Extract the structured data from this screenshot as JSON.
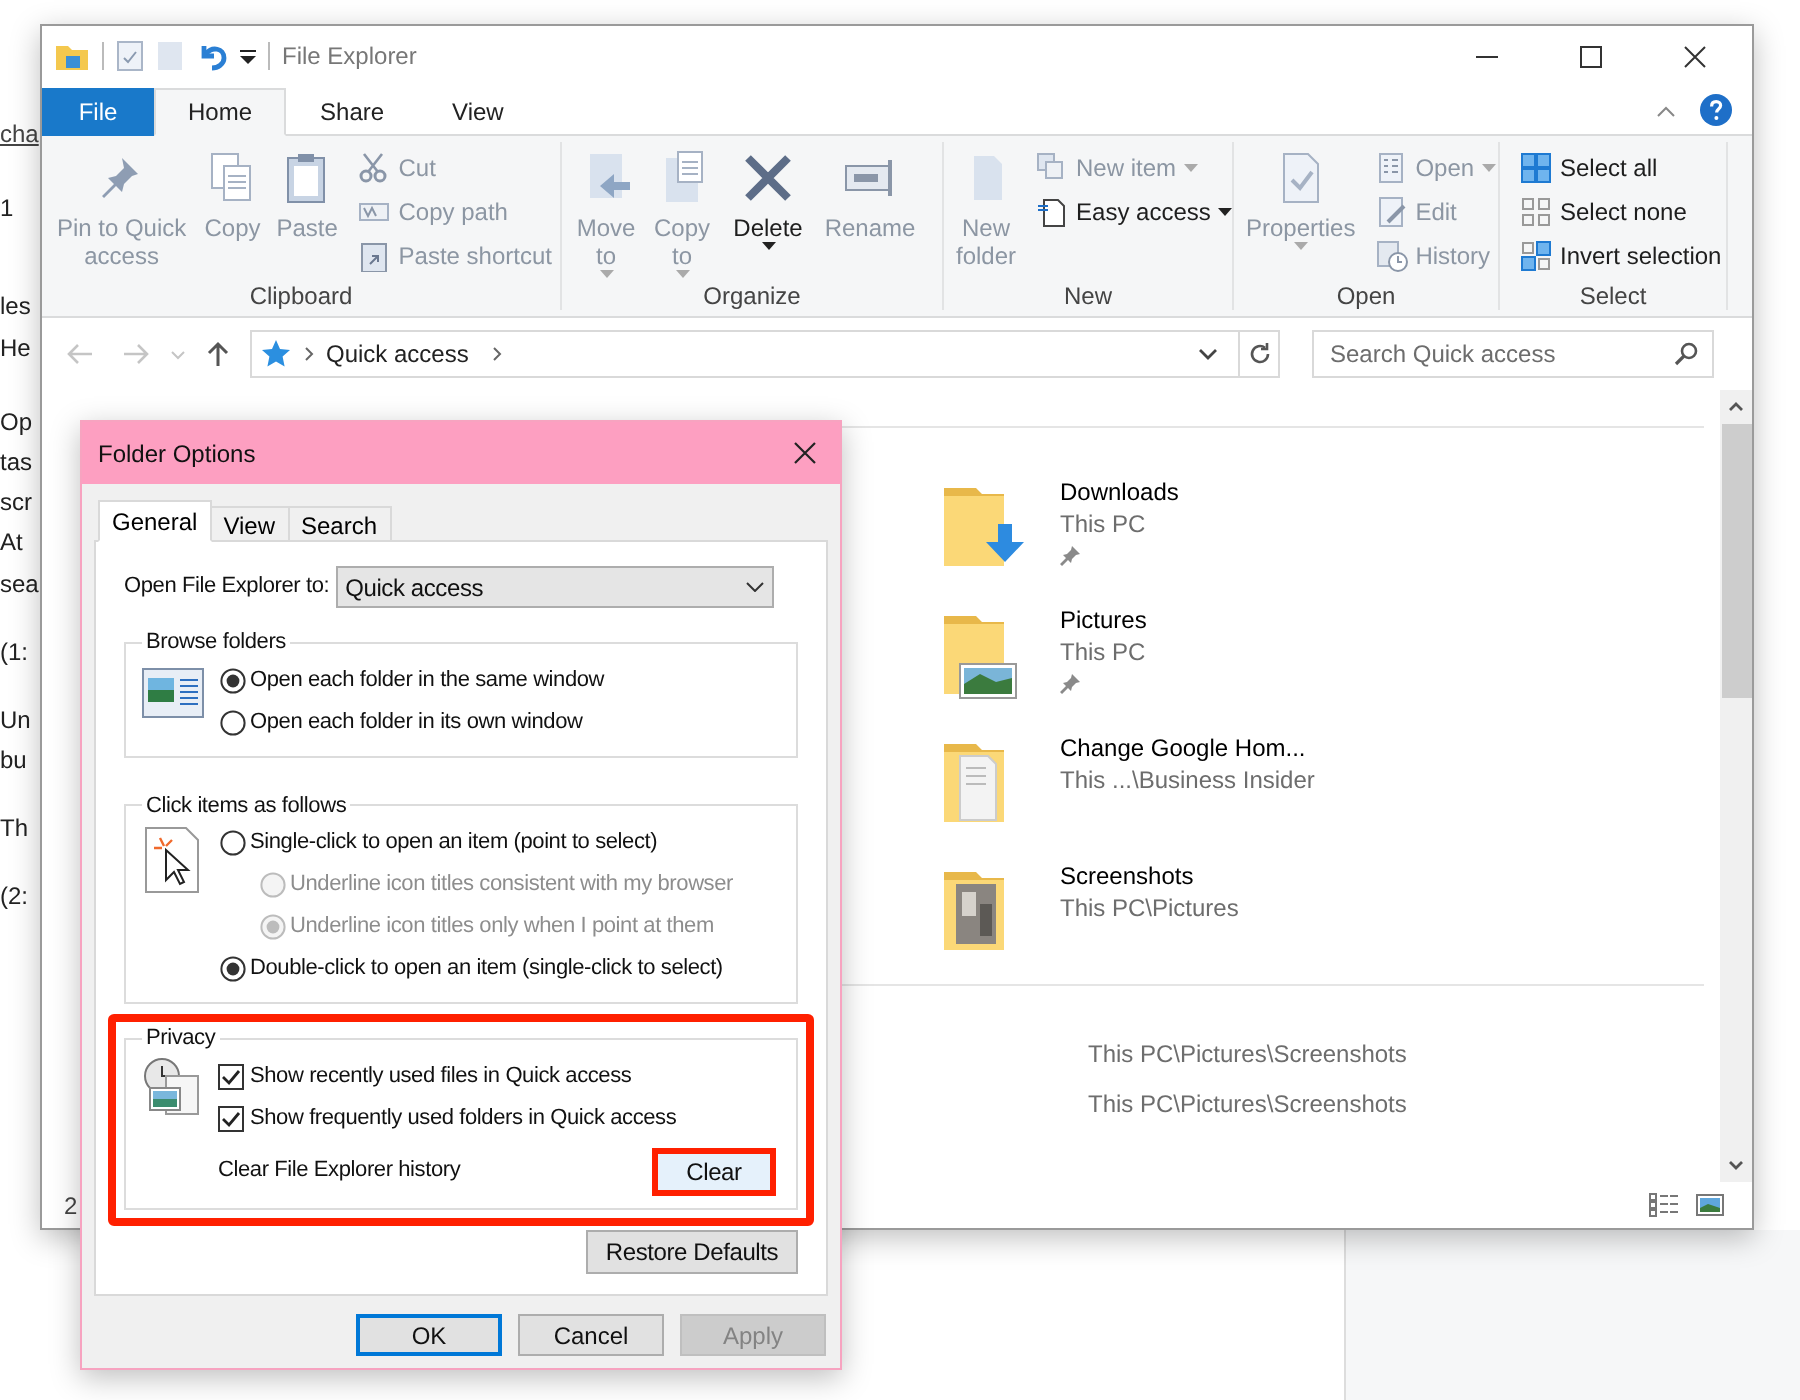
{
  "background_document": {
    "lines": [
      {
        "text": "cha",
        "link": true
      },
      {
        "text": "1",
        "link": false
      },
      {
        "text": "les",
        "link": false
      },
      {
        "text": "He",
        "link": false
      },
      {
        "text": "Op",
        "link": false
      },
      {
        "text": "tas",
        "link": false
      },
      {
        "text": "scr",
        "link": false
      },
      {
        "text": "At",
        "link": false
      },
      {
        "text": "sea",
        "link": false
      },
      {
        "text": "(1:",
        "link": false
      },
      {
        "text": "Un",
        "link": false
      },
      {
        "text": "bu",
        "link": false
      },
      {
        "text": "Th",
        "link": false
      },
      {
        "text": "(2:",
        "link": false
      }
    ]
  },
  "explorer": {
    "title": "File Explorer",
    "tabs": [
      {
        "label": "File",
        "kind": "file",
        "selected": false
      },
      {
        "label": "Home",
        "kind": "tab",
        "selected": true
      },
      {
        "label": "Share",
        "kind": "tab",
        "selected": false
      },
      {
        "label": "View",
        "kind": "tab",
        "selected": false
      }
    ],
    "ribbon": [
      {
        "label": "Clipboard",
        "items": [
          {
            "label": "Pin to Quick access",
            "kind": "large",
            "disabled": true,
            "dropdown": false
          },
          {
            "label": "Copy",
            "kind": "large",
            "disabled": true,
            "dropdown": false
          },
          {
            "label": "Paste",
            "kind": "large",
            "disabled": true,
            "dropdown": false
          },
          {
            "label": "Cut",
            "kind": "small",
            "disabled": true,
            "dropdown": false
          },
          {
            "label": "Copy path",
            "kind": "small",
            "disabled": true,
            "dropdown": false
          },
          {
            "label": "Paste shortcut",
            "kind": "small",
            "disabled": true,
            "dropdown": false
          }
        ]
      },
      {
        "label": "Organize",
        "items": [
          {
            "label": "Move to",
            "kind": "large",
            "disabled": true,
            "dropdown": true
          },
          {
            "label": "Copy to",
            "kind": "large",
            "disabled": true,
            "dropdown": true
          },
          {
            "label": "Delete",
            "kind": "large",
            "disabled": false,
            "dropdown": true
          },
          {
            "label": "Rename",
            "kind": "large",
            "disabled": true,
            "dropdown": false
          }
        ]
      },
      {
        "label": "New",
        "items": [
          {
            "label": "New folder",
            "kind": "large",
            "disabled": true,
            "dropdown": false
          },
          {
            "label": "New item",
            "kind": "small",
            "disabled": true,
            "dropdown": true
          },
          {
            "label": "Easy access",
            "kind": "small",
            "disabled": false,
            "dropdown": true
          }
        ]
      },
      {
        "label": "Open",
        "items": [
          {
            "label": "Properties",
            "kind": "large",
            "disabled": true,
            "dropdown": true
          },
          {
            "label": "Open",
            "kind": "small",
            "disabled": true,
            "dropdown": true
          },
          {
            "label": "Edit",
            "kind": "small",
            "disabled": true,
            "dropdown": false
          },
          {
            "label": "History",
            "kind": "small",
            "disabled": true,
            "dropdown": false
          }
        ]
      },
      {
        "label": "Select",
        "items": [
          {
            "label": "Select all",
            "kind": "small",
            "disabled": false,
            "dropdown": false
          },
          {
            "label": "Select none",
            "kind": "small",
            "disabled": false,
            "dropdown": false
          },
          {
            "label": "Invert selection",
            "kind": "small",
            "disabled": false,
            "dropdown": false
          }
        ]
      }
    ],
    "address": {
      "path": "Quick access"
    },
    "search": {
      "placeholder": "Search Quick access"
    },
    "folders": [
      {
        "name": "Downloads",
        "location": "This PC",
        "pinned": true
      },
      {
        "name": "Pictures",
        "location": "This PC",
        "pinned": true
      },
      {
        "name": "Change Google Hom...",
        "location": "This ...\\Business Insider",
        "pinned": false
      },
      {
        "name": "Screenshots",
        "location": "This PC\\Pictures",
        "pinned": false
      }
    ],
    "recent_files": [
      {
        "location": "This PC\\Pictures\\Screenshots"
      },
      {
        "location": "This PC\\Pictures\\Screenshots"
      }
    ],
    "status_bar": {
      "item_count": "2"
    }
  },
  "dialog": {
    "title": "Folder Options",
    "tabs": [
      {
        "label": "General",
        "selected": true
      },
      {
        "label": "View",
        "selected": false
      },
      {
        "label": "Search",
        "selected": false
      }
    ],
    "open_to": {
      "label": "Open File Explorer to:",
      "value": "Quick access"
    },
    "browse_folders": {
      "title": "Browse folders",
      "options": [
        {
          "label": "Open each folder in the same window",
          "selected": true,
          "disabled": false
        },
        {
          "label": "Open each folder in its own window",
          "selected": false,
          "disabled": false
        }
      ]
    },
    "click_items": {
      "title": "Click items as follows",
      "options": [
        {
          "label": "Single-click to open an item (point to select)",
          "selected": false,
          "disabled": false,
          "children": [
            {
              "label": "Underline icon titles consistent with my browser",
              "selected": false,
              "disabled": true
            },
            {
              "label": "Underline icon titles only when I point at them",
              "selected": true,
              "disabled": true
            }
          ]
        },
        {
          "label": "Double-click to open an item (single-click to select)",
          "selected": true,
          "disabled": false
        }
      ]
    },
    "privacy": {
      "title": "Privacy",
      "checkboxes": [
        {
          "label": "Show recently used files in Quick access",
          "checked": true
        },
        {
          "label": "Show frequently used folders in Quick access",
          "checked": true
        }
      ],
      "clear_label": "Clear File Explorer history",
      "clear_button": "Clear"
    },
    "restore_button": "Restore Defaults",
    "buttons": [
      {
        "label": "OK",
        "default": true,
        "disabled": false
      },
      {
        "label": "Cancel",
        "default": false,
        "disabled": false
      },
      {
        "label": "Apply",
        "default": false,
        "disabled": true
      }
    ]
  }
}
